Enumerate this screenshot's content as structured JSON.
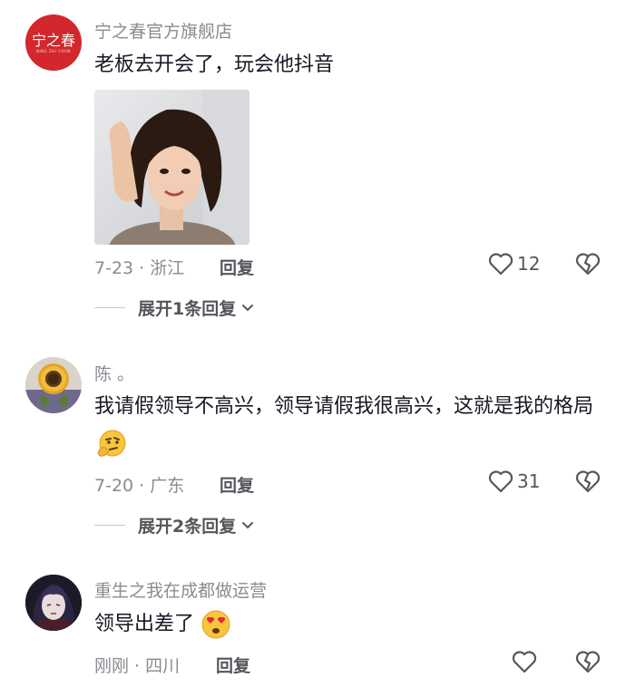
{
  "comments": [
    {
      "avatar_text": "宁之春",
      "avatar_subtext": "NING ZHI CHUN",
      "name": "宁之春官方旗舰店",
      "text": "老板去开会了，玩会他抖音",
      "meta": "7-23 · 浙江",
      "reply_label": "回复",
      "likes": "12",
      "expand_label": "展开1条回复"
    },
    {
      "name": "陈 。",
      "text": "我请假领导不高兴，领导请假我很高兴，这就是我的格局",
      "meta": "7-20 · 广东",
      "reply_label": "回复",
      "likes": "31",
      "expand_label": "展开2条回复"
    },
    {
      "name": "重生之我在成都做运营",
      "text": "领导出差了",
      "meta": "刚刚 · 四川",
      "reply_label": "回复",
      "likes": ""
    }
  ],
  "icons": {
    "like": "heart-outline-icon",
    "dislike": "broken-heart-icon",
    "expand": "chevron-down-icon"
  },
  "colors": {
    "brand_red": "#d2272c",
    "secondary_text": "#8a8b91",
    "primary_text": "#161823"
  }
}
